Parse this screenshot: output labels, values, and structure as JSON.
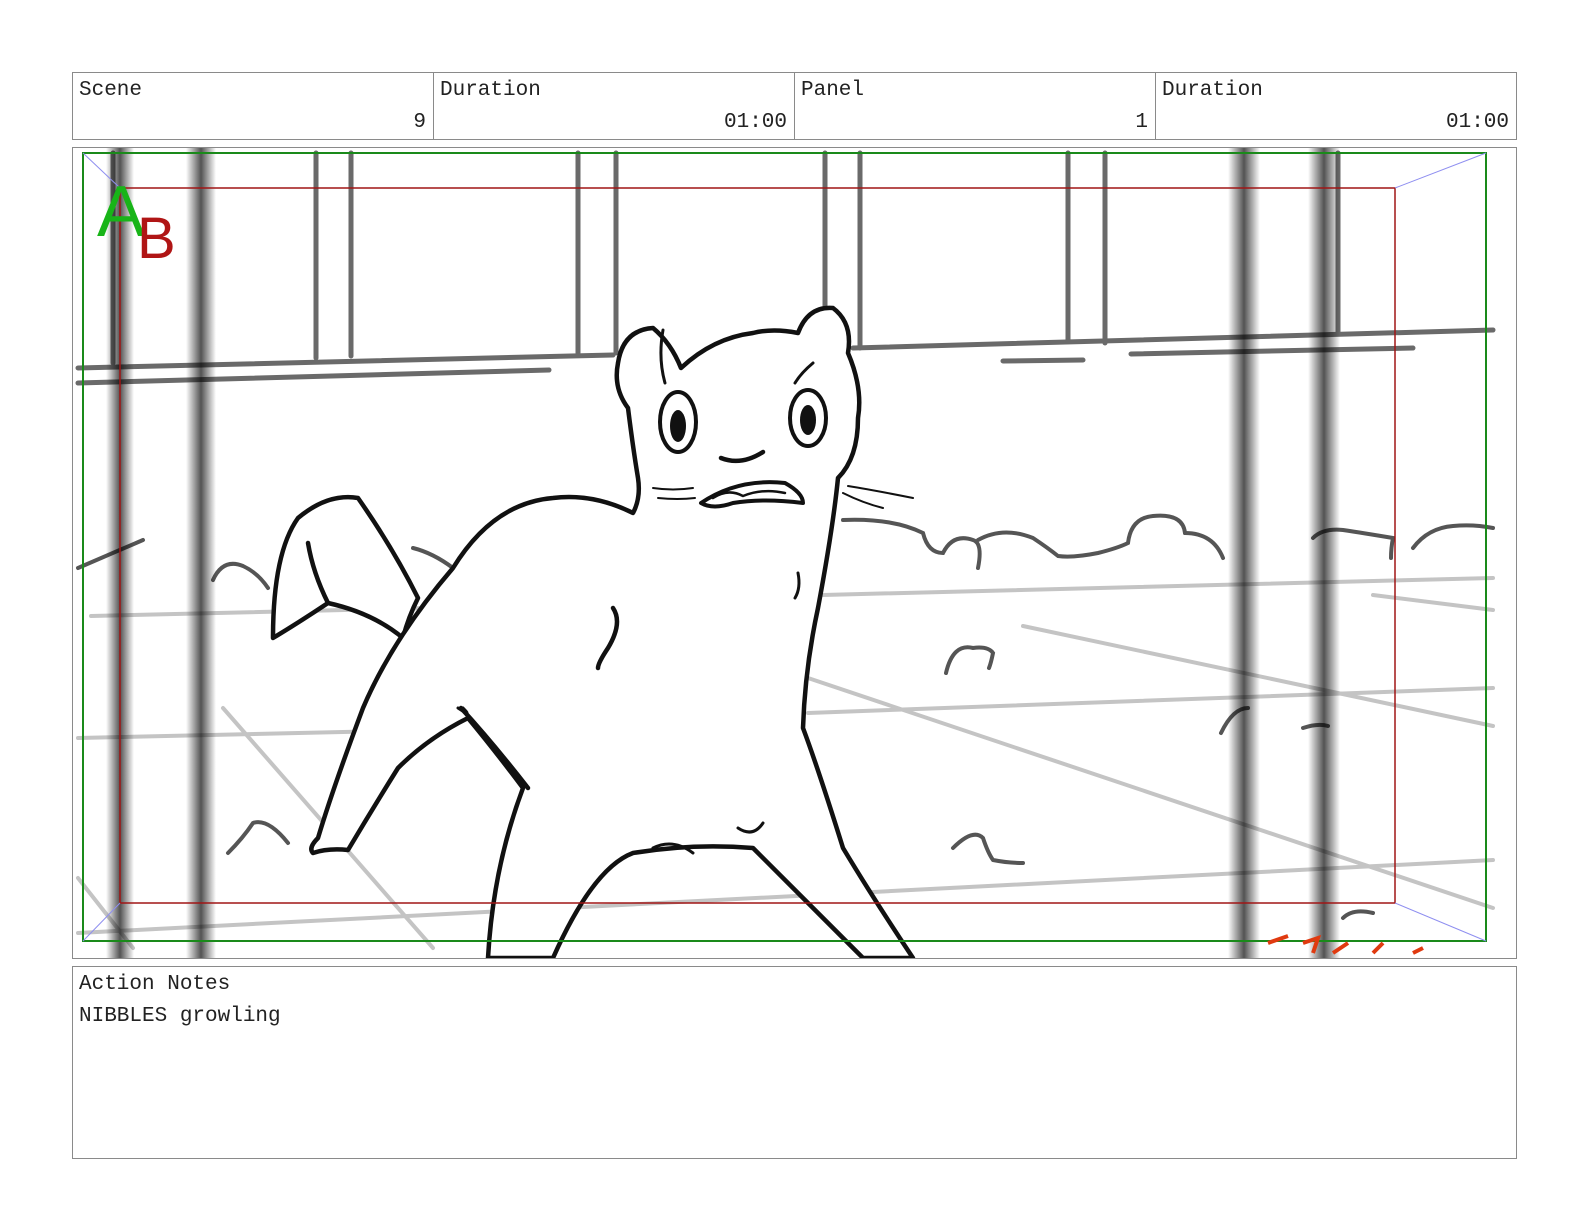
{
  "header": {
    "scene_label": "Scene",
    "scene_value": "9",
    "scene_duration_label": "Duration",
    "scene_duration_value": "01:00",
    "panel_label": "Panel",
    "panel_value": "1",
    "panel_duration_label": "Duration",
    "panel_duration_value": "01:00"
  },
  "frame": {
    "safe_area_mark_a": "A",
    "safe_area_mark_b": "B",
    "action_safe_color": "#1a8a1a",
    "title_safe_color": "#a01515"
  },
  "notes": {
    "label": "Action Notes",
    "text": "NIBBLES growling"
  }
}
